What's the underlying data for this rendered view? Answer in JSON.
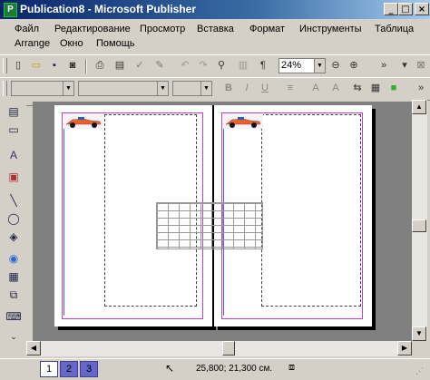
{
  "window": {
    "title": "Publication8 - Microsoft Publisher",
    "app_icon": "publisher-icon"
  },
  "menu": {
    "row1": [
      "Файл",
      "Редактирование",
      "Просмотр",
      "Вставка",
      "Формат",
      "Инструменты",
      "Таблица"
    ],
    "row2": [
      "Arrange",
      "Окно",
      "Помощь"
    ]
  },
  "toolbar": {
    "zoom": "24%",
    "icons": [
      "new-icon",
      "open-icon",
      "save-icon",
      "search-file-icon",
      "print-icon",
      "print-preview-icon",
      "spelling-icon",
      "format-painter-icon",
      "undo-icon",
      "redo-icon",
      "zoom-glass-icon",
      "columns-icon",
      "paragraph-icon",
      "zoom-out-icon",
      "zoom-in-icon"
    ]
  },
  "format_toolbar": {
    "style_value": "",
    "font_value": "",
    "size_value": "",
    "bold": "B",
    "italic": "I",
    "underline": "U"
  },
  "pages": {
    "tabs": [
      "1",
      "2",
      "3"
    ],
    "active": "1"
  },
  "status": {
    "position": "25,800; 21,300 см."
  }
}
